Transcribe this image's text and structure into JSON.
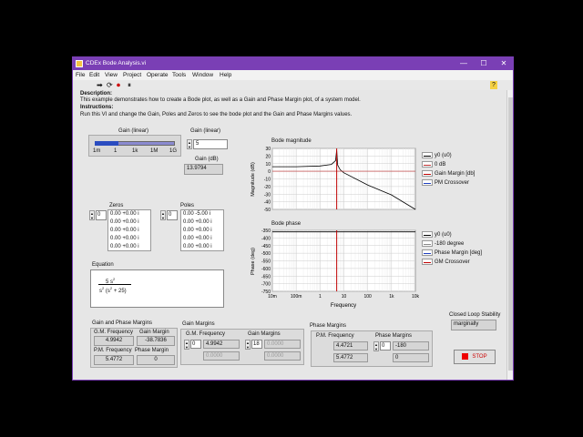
{
  "window": {
    "title": "CDEx Bode Analysis.vi",
    "min": "—",
    "max": "☐",
    "close": "✕"
  },
  "menu": [
    "File",
    "Edit",
    "View",
    "Project",
    "Operate",
    "Tools",
    "Window",
    "Help"
  ],
  "toolbar": {
    "run": "➡",
    "run_cont": "⟳",
    "abort": "⏺",
    "pause": "⏸",
    "help": "?"
  },
  "description": {
    "heading": "Description:",
    "body": "This example demonstrates how to create a Bode plot, as well as a Gain and Phase Margin plot, of a system model.",
    "instr_heading": "Instructions:",
    "instr_body": "Run this VI and change the Gain, Poles and Zeros to see the bode plot and the Gain and Phase Margins values."
  },
  "gain_slider": {
    "label": "Gain (linear)",
    "ticks": [
      "1m",
      "1",
      "1k",
      "1M",
      "1G"
    ],
    "fraction": 0.3
  },
  "gain_linear": {
    "label": "Gain (linear)",
    "value": "5"
  },
  "gain_db": {
    "label": "Gain (dB)",
    "value": "13.9794"
  },
  "zeros": {
    "label": "Zeros",
    "index": "0",
    "rows": [
      "0.00 +0.00 i",
      "0.00 +0.00 i",
      "0.00 +0.00 i",
      "0.00 +0.00 i",
      "0.00 +0.00 i"
    ]
  },
  "poles": {
    "label": "Poles",
    "index": "0",
    "rows": [
      "0.00 -5.00 i",
      "0.00 +0.00 i",
      "0.00 +0.00 i",
      "0.00 +0.00 i",
      "0.00 +0.00 i"
    ]
  },
  "equation": {
    "label": "Equation",
    "num": "5 s",
    "num_exp": "2",
    "den_a": "s",
    "den_a_exp": "2",
    "den_b": "(s",
    "den_b_exp": "2",
    "den_c": "+ 25)"
  },
  "bode_mag": {
    "title": "Bode magnitude",
    "ylabel": "Magnitude (dB)",
    "yticks": [
      "30",
      "20",
      "10",
      "0",
      "-10",
      "-20",
      "-30",
      "-40",
      "-50"
    ],
    "legend": [
      {
        "name": "y0 (u0)",
        "color": "#000000"
      },
      {
        "name": "0 dB",
        "color": "#c03030"
      },
      {
        "name": "Gain Margin [db]",
        "color": "#c00000"
      },
      {
        "name": "PM Crossover",
        "color": "#1f3fbf"
      }
    ]
  },
  "bode_phase": {
    "title": "Bode phase",
    "ylabel": "Phase (deg)",
    "xlabel": "Frequency",
    "yticks": [
      "-350",
      "-400",
      "-450",
      "-500",
      "-550",
      "-600",
      "-650",
      "-700",
      "-750"
    ],
    "xticks": [
      "10m",
      "100m",
      "1",
      "10",
      "100",
      "1k",
      "10k"
    ],
    "legend": [
      {
        "name": "y0 (u0)",
        "color": "#000000"
      },
      {
        "name": "-180 degree",
        "color": "#888888"
      },
      {
        "name": "Phase Margin [deg]",
        "color": "#1f3fbf"
      },
      {
        "name": "GM Crossover",
        "color": "#c00000"
      }
    ]
  },
  "chart_data": [
    {
      "type": "line",
      "title": "Bode magnitude",
      "xlabel": "Frequency",
      "ylabel": "Magnitude (dB)",
      "xscale": "log",
      "xlim": [
        0.01,
        10000
      ],
      "ylim": [
        -50,
        30
      ],
      "grid": true,
      "series": [
        {
          "name": "y0 (u0)",
          "x": [
            0.01,
            0.1,
            1,
            3,
            4.5,
            5,
            5.5,
            7,
            10,
            100,
            1000,
            10000
          ],
          "y": [
            6,
            6,
            7,
            9,
            14,
            28,
            8,
            2,
            -2,
            -18,
            -31,
            -50
          ]
        },
        {
          "name": "0 dB",
          "x": [
            0.01,
            10000
          ],
          "y": [
            0,
            0
          ]
        }
      ],
      "markers": [
        {
          "name": "Gain Margin [db]",
          "x": 5
        }
      ]
    },
    {
      "type": "line",
      "title": "Bode phase",
      "xlabel": "Frequency",
      "ylabel": "Phase (deg)",
      "xscale": "log",
      "xlim": [
        0.01,
        10000
      ],
      "ylim": [
        -750,
        -350
      ],
      "grid": true,
      "series": [
        {
          "name": "y0 (u0)",
          "x": [
            0.01,
            10000
          ],
          "y": [
            -360,
            -360
          ]
        }
      ],
      "markers": [
        {
          "name": "GM Crossover",
          "x": 5
        }
      ]
    }
  ],
  "gpm": {
    "title": "Gain and Phase Margins",
    "gm_freq_label": "G.M. Frequency",
    "gm_freq": "4.9942",
    "gm_label": "Gain Margin",
    "gm": "-38.7836",
    "pm_freq_label": "P.M. Frequency",
    "pm_freq": "5.4772",
    "pm_label": "Phase Margin",
    "pm": "0"
  },
  "gain_margins": {
    "title": "Gain Margins",
    "freq_label": "G.M. Frequency",
    "idx1": "0",
    "f1": "4.9942",
    "f2": "0.0000",
    "gm_label": "Gain Margins",
    "idx2": "18",
    "g1": "0.0000",
    "g2": "0.0000"
  },
  "phase_margins": {
    "title": "Phase Margins",
    "freq_label": "P.M. Frequency",
    "idx1": "0",
    "f1": "4.4721",
    "f2": "5.4772",
    "pm_label": "Phase Margins",
    "idx2": "0",
    "p1": "-180",
    "p2": "0"
  },
  "stability": {
    "label": "Closed Loop Stability",
    "value": "marginally"
  },
  "stop": {
    "label": "STOP"
  }
}
